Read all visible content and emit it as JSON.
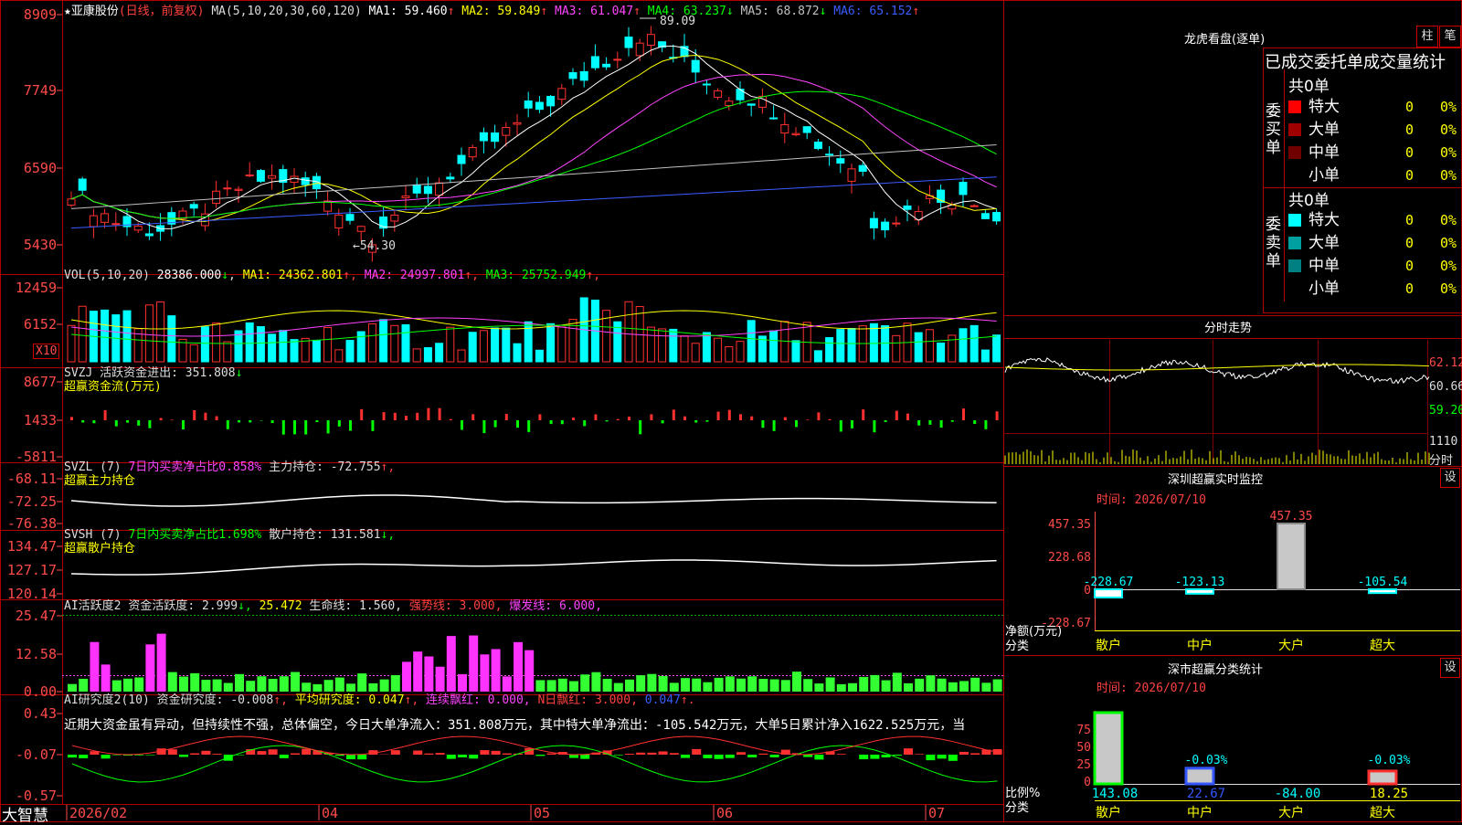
{
  "stock": {
    "title": "★亚康股份",
    "period": "(日线，前复权)"
  },
  "brand": "大智慧",
  "date_labels": [
    "2026/02",
    "04",
    "05",
    "06",
    "07"
  ],
  "indicators": {
    "ma": {
      "label": "MA(5,10,20,30,60,120)",
      "items": [
        {
          "name": "MA1:",
          "value": "59.460",
          "arrow": "↑",
          "color": "#ffffff"
        },
        {
          "name": "MA2:",
          "value": "59.849",
          "arrow": "↑",
          "color": "#ffff00"
        },
        {
          "name": "MA3:",
          "value": "61.047",
          "arrow": "↑",
          "color": "#ff44ff"
        },
        {
          "name": "MA4:",
          "value": "63.237",
          "arrow": "↓",
          "color": "#00ff00"
        },
        {
          "name": "MA5:",
          "value": "68.872",
          "arrow": "↓",
          "color": "#c0c0c0"
        },
        {
          "name": "MA6:",
          "value": "65.152",
          "arrow": "↑",
          "color": "#3a5cff"
        }
      ]
    },
    "vol": {
      "label": "VOL(5,10,20)",
      "value": "28386.000",
      "arrow": "↓",
      "items": [
        {
          "name": "MA1:",
          "value": "24362.801",
          "arrow": "↑",
          "color": "#ffff00"
        },
        {
          "name": "MA2:",
          "value": "24997.801",
          "arrow": "↑",
          "color": "#ff44ff"
        },
        {
          "name": "MA3:",
          "value": "25752.949",
          "arrow": "↑",
          "color": "#00ff00"
        }
      ],
      "x10": "X10"
    },
    "svzj": {
      "label": "SVZJ",
      "text": "活跃资金进出:",
      "value": "351.808",
      "arrow": "↓",
      "sub": "超赢资金流(万元)"
    },
    "svzl": {
      "label": "SVZL (7)",
      "ratio_text": "7日内买卖净占比0.858%",
      "hold_text": "主力持仓:",
      "hold_value": "-72.755",
      "arrow": "↑,",
      "sub": "超赢主力持仓"
    },
    "svsh": {
      "label": "SVSH (7)",
      "ratio_text": "7日内买卖净占比1.698%",
      "hold_text": "散户持仓:",
      "hold_value": "131.581",
      "arrow": "↓,",
      "sub": "超赢散户持仓"
    },
    "ai_active": {
      "label": "AI活跃度2",
      "t1": "资金活跃度:",
      "v1": "2.999",
      "a1": "↓,",
      "v2": "25.472",
      "t3": "生命线:",
      "v3": "1.560,",
      "t4": "强势线:",
      "v4": "3.000,",
      "t5": "爆发线:",
      "v5": "6.000,"
    },
    "ai_research": {
      "label": "AI研究度2(10)",
      "t1": "资金研究度:",
      "v1": "-0.008",
      "a1": "↑,",
      "t2": "平均研究度:",
      "v2": "0.047",
      "a2": "↑,",
      "t3": "连续飘红:",
      "v3": "0.000,",
      "t4": "N日飘红:",
      "v4": "3.000,",
      "v5": "0.047",
      "a5": "↑.",
      "comment": "近期大资金虽有异动，但持续性不强，总体偏空，今日大单净流入：351.808万元，其中特大单净流出：-105.542万元，大单5日累计净入1622.525万元，当"
    }
  },
  "axes": {
    "price": [
      "8909",
      "7749",
      "6590",
      "5430"
    ],
    "vol": [
      "12459",
      "6152"
    ],
    "svzj": [
      "8677",
      "1433",
      "-5811"
    ],
    "svzl": [
      "-68.11",
      "-72.25",
      "-76.38"
    ],
    "svsh": [
      "134.47",
      "127.17",
      "120.14"
    ],
    "ai_active": [
      "25.47",
      "12.58",
      "0.00"
    ],
    "ai_research": [
      "0.43",
      "-0.07",
      "-0.57"
    ]
  },
  "annotations": {
    "high": "89.09",
    "low": "54.30"
  },
  "right_panel": {
    "dragon_title": "龙虎看盘(逐单)",
    "btn_bar": "柱",
    "btn_pen": "笔",
    "tabs_title": "已成交委托单成交量统计",
    "buy_label": "委买单",
    "sell_label": "委卖单",
    "buy_total": "共0单",
    "sell_total": "共0单",
    "buy_rows": [
      {
        "name": "特大",
        "count": "0",
        "pct": "0%",
        "color": "#ff0000"
      },
      {
        "name": "大单",
        "count": "0",
        "pct": "0%",
        "color": "#a00000"
      },
      {
        "name": "中单",
        "count": "0",
        "pct": "0%",
        "color": "#700000"
      },
      {
        "name": "小单",
        "count": "0",
        "pct": "0%",
        "color": "#000000"
      }
    ],
    "sell_rows": [
      {
        "name": "特大",
        "count": "0",
        "pct": "0%",
        "color": "#00ffff"
      },
      {
        "name": "大单",
        "count": "0",
        "pct": "0%",
        "color": "#00a0a0"
      },
      {
        "name": "中单",
        "count": "0",
        "pct": "0%",
        "color": "#008080"
      },
      {
        "name": "小单",
        "count": "0",
        "pct": "0%",
        "color": "#000000"
      }
    ],
    "intraday_title": "分时走势",
    "intraday_axis": [
      "62.12",
      "60.66",
      "59.20"
    ],
    "intraday_vol": "1110",
    "intraday_foot": "分时",
    "sz_monitor_title": "深圳超赢实时监控",
    "sz_monitor_btn": "设",
    "sz_monitor_date": "时间: 2026/07/10",
    "sz_monitor_axis": [
      "457.35",
      "228.68",
      "0",
      "-228.67"
    ],
    "sz_monitor_ylabel": "净额(万元)",
    "sz_monitor_xlabel": "分类",
    "sz_monitor_bars": [
      {
        "name": "散户",
        "value": -228.67,
        "label": "-228.67"
      },
      {
        "name": "中户",
        "value": -123.13,
        "label": "-123.13"
      },
      {
        "name": "大户",
        "value": 457.35,
        "label": "457.35"
      },
      {
        "name": "超大",
        "value": -105.54,
        "label": "-105.54"
      }
    ],
    "sz_class_title": "深市超赢分类统计",
    "sz_class_btn": "设",
    "sz_class_date": "时间: 2026/07/10",
    "sz_class_axis": [
      "75",
      "50",
      "25",
      "0"
    ],
    "sz_class_ylabel": "比例%",
    "sz_class_xlabel": "分类",
    "sz_class_bars": [
      {
        "name": "散户",
        "pct": 100,
        "label": "",
        "value": "143.08"
      },
      {
        "name": "中户",
        "pct": 22,
        "label": "-0.03%",
        "value": "22.67"
      },
      {
        "name": "大户",
        "pct": 0,
        "label": "",
        "value": "-84.00"
      },
      {
        "name": "超大",
        "pct": 18,
        "label": "-0.03%",
        "value": "18.25"
      }
    ]
  },
  "chart_data": {
    "type": "candlestick",
    "price_range": [
      53,
      90
    ],
    "high": 89.09,
    "low": 54.3,
    "bars": 84,
    "sz_monitor": {
      "categories": [
        "散户",
        "中户",
        "大户",
        "超大"
      ],
      "values": [
        -228.67,
        -123.13,
        457.35,
        -105.54
      ]
    },
    "sz_class": {
      "categories": [
        "散户",
        "中户",
        "大户",
        "超大"
      ],
      "values": [
        143.08,
        22.67,
        -84.0,
        18.25
      ]
    }
  }
}
